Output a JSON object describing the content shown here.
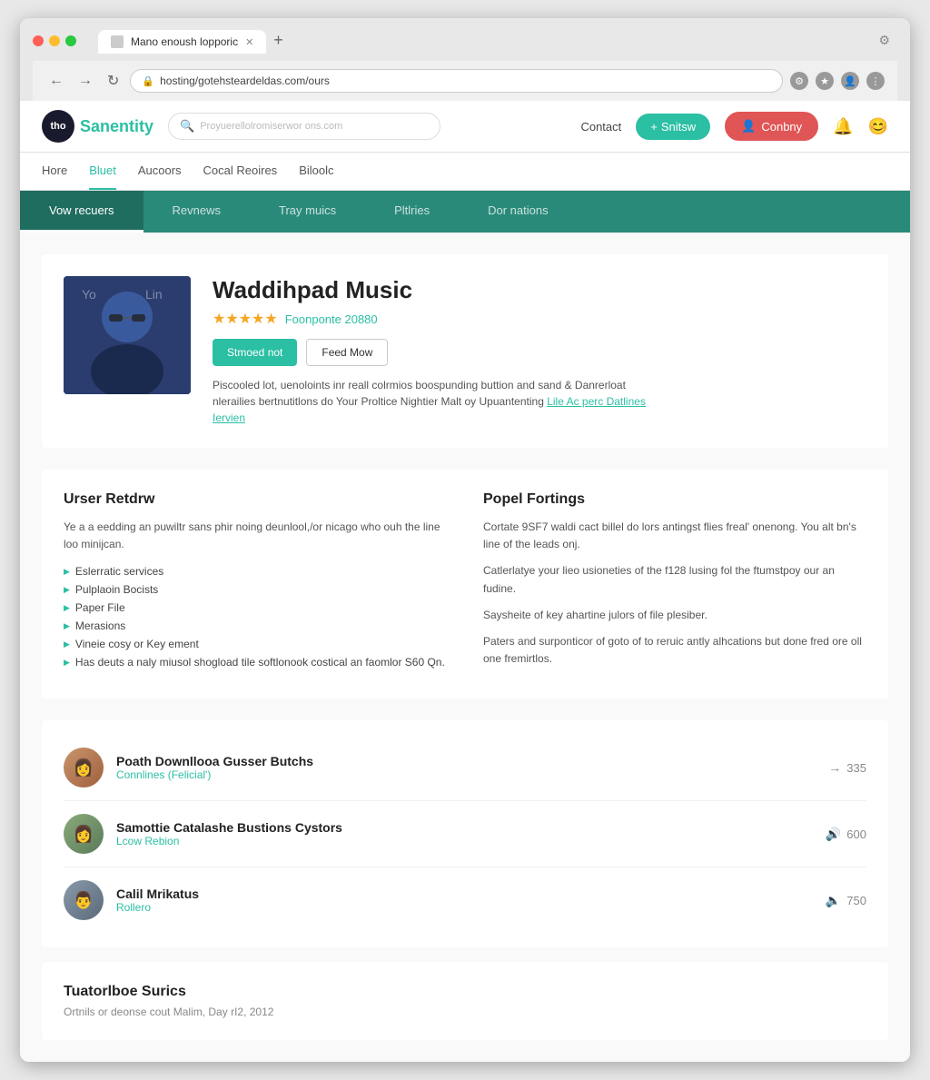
{
  "browser": {
    "tab_title": "Mano enoush lopporic",
    "url": "hosting/gotehsteardeldas.com/ours",
    "new_tab_label": "+",
    "back_btn": "←",
    "forward_btn": "→",
    "refresh_btn": "↻"
  },
  "header": {
    "logo_initials": "tho",
    "logo_name": "Sanentity",
    "search_placeholder": "Proyuerellolromiserwor ons.com",
    "contact_label": "Contact",
    "switch_btn": "Snitsw",
    "country_btn": "Conbny",
    "nav_items": [
      {
        "label": "Hore",
        "active": false
      },
      {
        "label": "Bluet",
        "active": true
      },
      {
        "label": "Aucoors",
        "active": false
      },
      {
        "label": "Cocal Reoires",
        "active": false
      },
      {
        "label": "Biloolc",
        "active": false
      }
    ]
  },
  "content_tabs": [
    {
      "label": "Vow recuers",
      "active": true
    },
    {
      "label": "Revnews",
      "active": false
    },
    {
      "label": "Tray muics",
      "active": false
    },
    {
      "label": "Pltlries",
      "active": false
    },
    {
      "label": "Dor nations",
      "active": false
    }
  ],
  "artist": {
    "name": "Waddihpad Music",
    "rating_stars": "★★★★★",
    "rating_count": "Foonponte 20880",
    "support_btn": "Stmoed not",
    "follow_btn": "Feed Mow",
    "description": "Piscooled lot, uenoloints inr reall colrmios boospunding buttion and sand & Danrerloat nlerailies bertnutitlons do Your Proltice Nightier Malt oy Upuantenting",
    "link_text": "Lile Ac perc Datlines Iervien"
  },
  "left_col": {
    "title": "Urser Retdrw",
    "text": "Ye a a eedding an puwiltr sans phir noing deunlool,/or nicago who ouh the line loo minijcan.",
    "features": [
      "Eslerratic services",
      "Pulplaoin Bocists",
      "Paper File",
      "Merasions",
      "Vineie cosy or Key ement",
      "Has deuts a naly miusol shogload tile softlonook costical an faomlor S60 Qn."
    ]
  },
  "right_col": {
    "title": "Popel Fortings",
    "paragraphs": [
      "Cortate 9SF7 waldi cact billel do lors antingst flies freal' onenong. You alt bn's line of the leads onj.",
      "Catlerlatye your lieo usioneties of the f128 lusing fol the ftumstpoy our an fudine.",
      "Saysheite of key ahartine julors of file plesiber.",
      "Paters and surponticor of goto of to reruic antly alhcations but done fred ore oll one fremirtlos."
    ]
  },
  "users": [
    {
      "name": "Poath Downllooa Gusser Butchs",
      "sub": "Connlines (Felicial')",
      "stat": "335",
      "stat_icon": "→",
      "color": "#b0856a"
    },
    {
      "name": "Samottie Catalashe Bustions Cystors",
      "sub": "Lcow Rebion",
      "stat": "600",
      "stat_icon": "🔊",
      "color": "#8a9a7a"
    },
    {
      "name": "Calil Mrikatus",
      "sub": "Rollero",
      "stat": "750",
      "stat_icon": "🔈",
      "color": "#7a8a9a"
    }
  ],
  "bottom": {
    "title": "Tuatorlboe Surics",
    "subtitle": "Ortnils or deonse cout Malim, Day rI2, 2012"
  }
}
